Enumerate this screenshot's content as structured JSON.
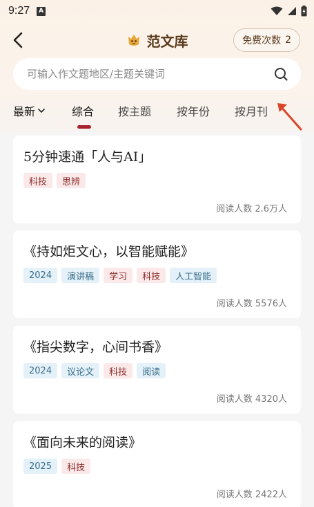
{
  "status_bar": {
    "time": "9:27",
    "notification_letter": "A"
  },
  "header": {
    "title": "范文库",
    "quota_label": "免费次数",
    "quota_count": "2"
  },
  "search": {
    "placeholder": "可输入作文题地区/主题关键词"
  },
  "tabs": {
    "sort_label": "最新",
    "items": [
      "综合",
      "按主题",
      "按年份",
      "按月刊"
    ],
    "active": "综合"
  },
  "cards": [
    {
      "title": "5分钟速通「人与AI」",
      "tags": [
        {
          "text": "科技",
          "tone": "red"
        },
        {
          "text": "思辨",
          "tone": "red"
        }
      ],
      "reads": "阅读人数 2.6万人"
    },
    {
      "title": "《持如炬文心，以智能赋能》",
      "tags": [
        {
          "text": "2024",
          "tone": "blue"
        },
        {
          "text": "演讲稿",
          "tone": "blue"
        },
        {
          "text": "学习",
          "tone": "red"
        },
        {
          "text": "科技",
          "tone": "red"
        },
        {
          "text": "人工智能",
          "tone": "blue"
        }
      ],
      "reads": "阅读人数 5576人"
    },
    {
      "title": "《指尖数字，心间书香》",
      "tags": [
        {
          "text": "2024",
          "tone": "blue"
        },
        {
          "text": "议论文",
          "tone": "blue"
        },
        {
          "text": "科技",
          "tone": "red"
        },
        {
          "text": "阅读",
          "tone": "blue"
        }
      ],
      "reads": "阅读人数 4320人"
    },
    {
      "title": "《面向未来的阅读》",
      "tags": [
        {
          "text": "2025",
          "tone": "blue"
        },
        {
          "text": "科技",
          "tone": "red"
        }
      ],
      "reads": "阅读人数 2422人"
    }
  ],
  "colors": {
    "accent": "#a8222a",
    "brand_brown": "#5a3a1c",
    "annotation_arrow": "#d9452b"
  },
  "icons": [
    "back-arrow-icon",
    "library-logo-icon",
    "search-icon",
    "chevron-down-icon",
    "wifi-icon",
    "signal-icon",
    "battery-icon"
  ]
}
